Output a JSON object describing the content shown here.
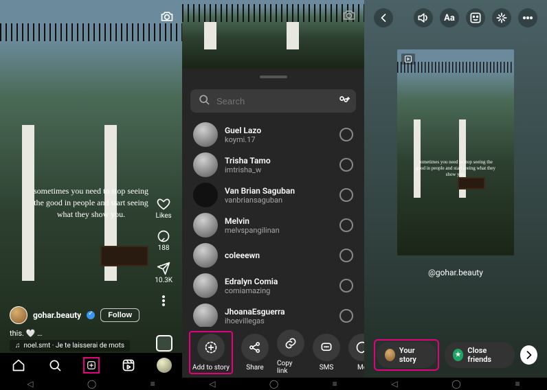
{
  "screen1": {
    "quote": "sometimes you need to stop seeing the good in people and start seeing what they show you.",
    "likes_label": "Likes",
    "comment_count": "188",
    "share_count": "10.3K",
    "username": "gohar.beauty",
    "follow_label": "Follow",
    "caption": "this. 🤍 …",
    "audio": "noel.smt · Je te laisserai de mots"
  },
  "screen2": {
    "search_placeholder": "Search",
    "users": [
      {
        "name": "Guel Lazo",
        "username": "koymi.17"
      },
      {
        "name": "Trisha Tamo",
        "username": "imtrisha_w"
      },
      {
        "name": "Van Brian Saguban",
        "username": "vanbriansaguban"
      },
      {
        "name": "Melvin",
        "username": "melvspangilinan"
      },
      {
        "name": "coleeewn",
        "username": ""
      },
      {
        "name": "Edralyn Comia",
        "username": "comiamazing"
      },
      {
        "name": "JhoanaEsguerra",
        "username": "ihoevillegas"
      }
    ],
    "actions": {
      "add_to_story": "Add to story",
      "share": "Share",
      "copy_link": "Copy link",
      "sms": "SMS",
      "me": "Me"
    }
  },
  "screen3": {
    "quote": "sometimes you need to stop seeing the good in people and start seeing what they show you.",
    "handle": "@gohar.beauty",
    "your_story": "Your story",
    "close_friends": "Close friends"
  },
  "highlight_color": "#e6007e"
}
